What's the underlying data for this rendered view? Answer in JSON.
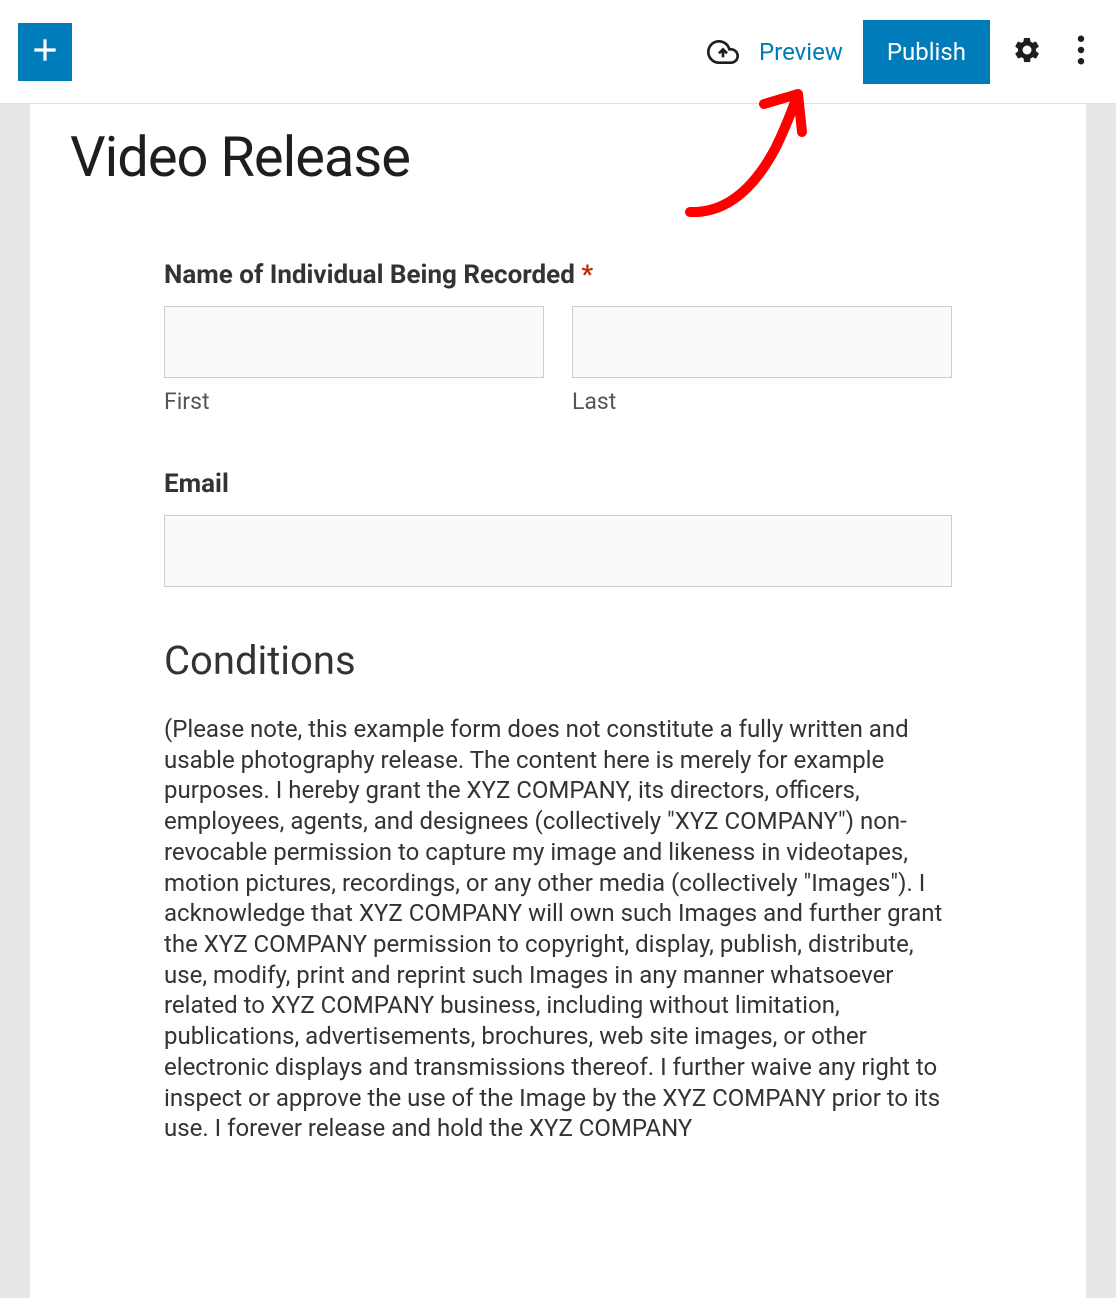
{
  "toolbar": {
    "add_icon": "plus-icon",
    "cloud_icon": "cloud-save-icon",
    "preview_label": "Preview",
    "publish_label": "Publish",
    "settings_icon": "gear-icon",
    "more_icon": "more-vertical-icon"
  },
  "page": {
    "title": "Video Release"
  },
  "form": {
    "name": {
      "label": "Name of Individual Being Recorded",
      "required_mark": "*",
      "first_sub": "First",
      "last_sub": "Last",
      "first_value": "",
      "last_value": ""
    },
    "email": {
      "label": "Email",
      "value": ""
    },
    "conditions": {
      "heading": "Conditions",
      "body": "(Please note, this example form does not constitute a fully written and usable photography release. The content here is merely for example purposes. I hereby grant the XYZ COMPANY, its directors, officers, employees, agents, and designees (collectively \"XYZ COMPANY\") non-revocable permission to capture my image and likeness in videotapes, motion pictures, recordings, or any other media (collectively \"Images\"). I acknowledge that XYZ COMPANY will own such Images and further grant the XYZ COMPANY permission to copyright, display, publish, distribute, use, modify, print and reprint such Images in any manner whatsoever related to XYZ COMPANY business, including without limitation, publications, advertisements, brochures, web site images, or other electronic displays and transmissions thereof. I further waive any right to inspect or approve the use of the Image by the XYZ COMPANY prior to its use. I forever release and hold the XYZ COMPANY"
    }
  },
  "annotation": {
    "arrow_color": "#ff0000"
  }
}
